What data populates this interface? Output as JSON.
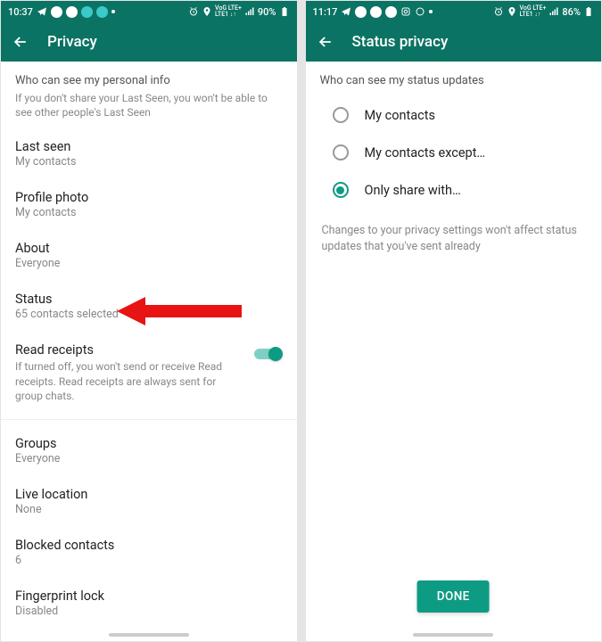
{
  "left": {
    "status": {
      "time": "10:37",
      "battery": "90%"
    },
    "title": "Privacy",
    "section1": {
      "header": "Who can see my personal info",
      "desc": "If you don't share your Last Seen, you won't be able to see other people's Last Seen"
    },
    "items": {
      "last_seen": {
        "title": "Last seen",
        "value": "My contacts"
      },
      "profile_photo": {
        "title": "Profile photo",
        "value": "My contacts"
      },
      "about": {
        "title": "About",
        "value": "Everyone"
      },
      "status": {
        "title": "Status",
        "value": "65 contacts selected"
      },
      "read_receipts": {
        "title": "Read receipts",
        "desc": "If turned off, you won't send or receive Read receipts. Read receipts are always sent for group chats."
      },
      "groups": {
        "title": "Groups",
        "value": "Everyone"
      },
      "live_location": {
        "title": "Live location",
        "value": "None"
      },
      "blocked": {
        "title": "Blocked contacts",
        "value": "6"
      },
      "fingerprint": {
        "title": "Fingerprint lock",
        "value": "Disabled"
      }
    }
  },
  "right": {
    "status": {
      "time": "11:17",
      "battery": "86%"
    },
    "title": "Status privacy",
    "header": "Who can see my status updates",
    "options": [
      {
        "label": "My contacts",
        "selected": false
      },
      {
        "label": "My contacts except…",
        "selected": false
      },
      {
        "label": "Only share with…",
        "selected": true
      }
    ],
    "helper": "Changes to your privacy settings won't affect status updates that you've sent already",
    "done": "DONE"
  }
}
